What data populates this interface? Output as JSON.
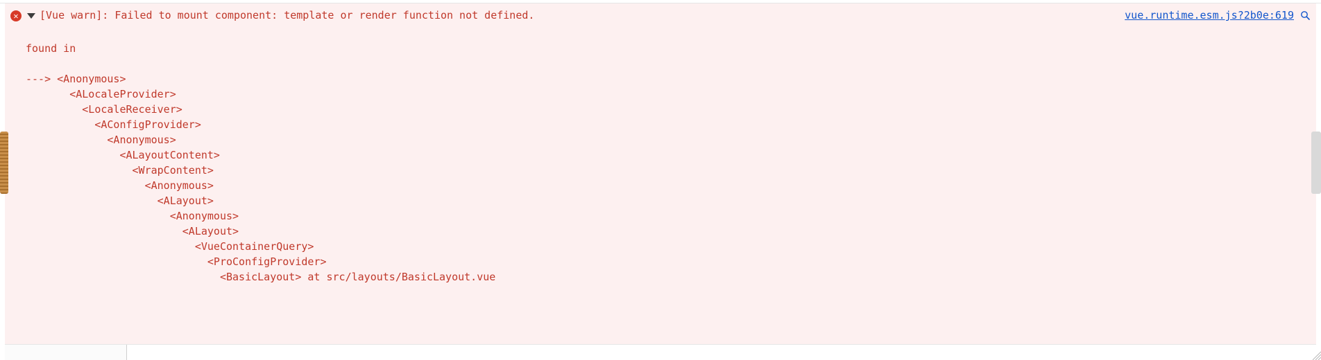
{
  "error": {
    "message": "[Vue warn]: Failed to mount component: template or render function not defined.",
    "found_in_label": "found in",
    "trace": [
      {
        "indent": 0,
        "text": "---> <Anonymous>"
      },
      {
        "indent": 7,
        "text": "<ALocaleProvider>"
      },
      {
        "indent": 9,
        "text": "<LocaleReceiver>"
      },
      {
        "indent": 11,
        "text": "<AConfigProvider>"
      },
      {
        "indent": 13,
        "text": "<Anonymous>"
      },
      {
        "indent": 15,
        "text": "<ALayoutContent>"
      },
      {
        "indent": 17,
        "text": "<WrapContent>"
      },
      {
        "indent": 19,
        "text": "<Anonymous>"
      },
      {
        "indent": 21,
        "text": "<ALayout>"
      },
      {
        "indent": 23,
        "text": "<Anonymous>"
      },
      {
        "indent": 25,
        "text": "<ALayout>"
      },
      {
        "indent": 27,
        "text": "<VueContainerQuery>"
      },
      {
        "indent": 29,
        "text": "<ProConfigProvider>"
      },
      {
        "indent": 31,
        "text": "<BasicLayout> at src/layouts/BasicLayout.vue"
      }
    ],
    "source_link": "vue.runtime.esm.js?2b0e:619"
  },
  "icons": {
    "error_glyph": "✕",
    "magnifier": "search-icon"
  }
}
